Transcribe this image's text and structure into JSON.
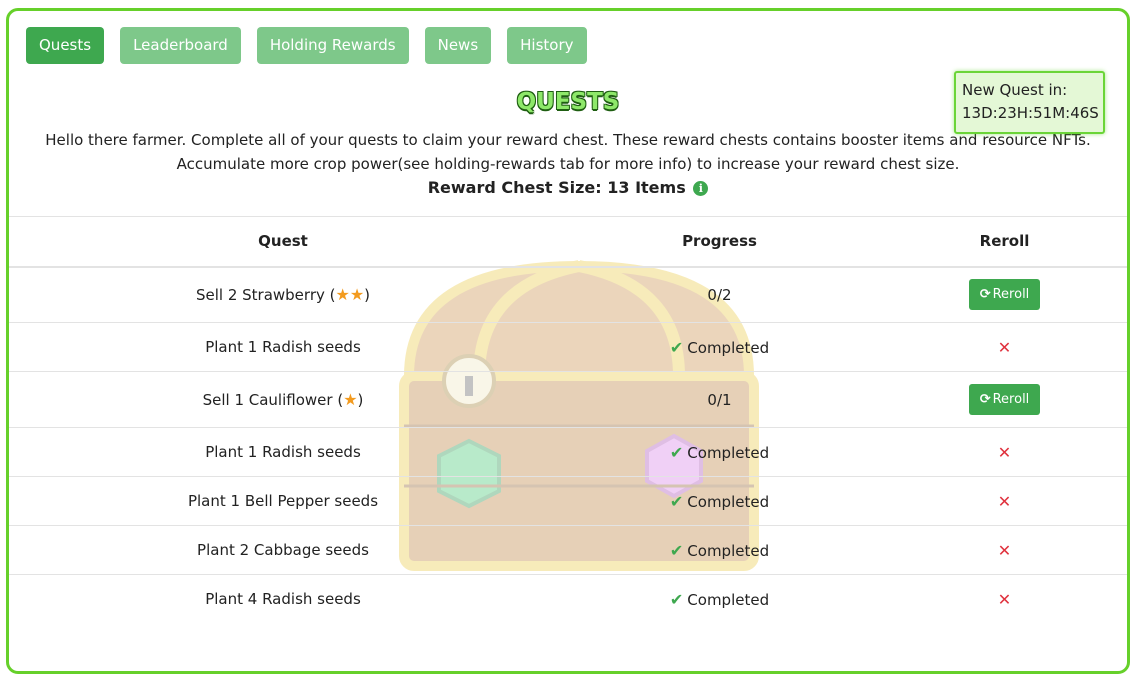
{
  "tabs": [
    {
      "label": "Quests",
      "active": true
    },
    {
      "label": "Leaderboard",
      "active": false
    },
    {
      "label": "Holding Rewards",
      "active": false
    },
    {
      "label": "News",
      "active": false
    },
    {
      "label": "History",
      "active": false
    }
  ],
  "timer": {
    "label": "New Quest in:",
    "value": "13D:23H:51M:46S"
  },
  "title": "QUESTS",
  "intro": {
    "line1": "Hello there farmer. Complete all of your quests to claim your reward chest. These reward chests contains booster items and resource NFTs.",
    "line2": "Accumulate more crop power(see holding-rewards tab for more info) to increase your reward chest size."
  },
  "chest_size": "Reward Chest Size: 13 Items",
  "table": {
    "headers": {
      "quest": "Quest",
      "progress": "Progress",
      "reroll": "Reroll"
    },
    "rows": [
      {
        "quest": "Sell 2 Strawberry (",
        "quest_end": ")",
        "stars": "★★",
        "progress": "0/2",
        "completed": false,
        "reroll": "Reroll"
      },
      {
        "quest": "Plant 1 Radish seeds",
        "progress": "Completed",
        "completed": true
      },
      {
        "quest": "Sell 1 Cauliflower (",
        "quest_end": ")",
        "stars": "★",
        "progress": "0/1",
        "completed": false,
        "reroll": "Reroll"
      },
      {
        "quest": "Plant 1 Radish seeds",
        "progress": "Completed",
        "completed": true
      },
      {
        "quest": "Plant 1 Bell Pepper seeds",
        "progress": "Completed",
        "completed": true
      },
      {
        "quest": "Plant 2 Cabbage seeds",
        "progress": "Completed",
        "completed": true
      },
      {
        "quest": "Plant 4 Radish seeds",
        "progress": "Completed",
        "completed": true
      }
    ]
  },
  "colors": {
    "accent": "#3ea84f",
    "tab_inactive": "#7ec88a",
    "frame": "#66d02a",
    "danger": "#e0323e",
    "star": "#f39b1f"
  },
  "icons": {
    "check": "check-icon",
    "close": "close-icon",
    "reroll": "refresh-icon",
    "info": "info-icon",
    "star": "star-icon"
  }
}
